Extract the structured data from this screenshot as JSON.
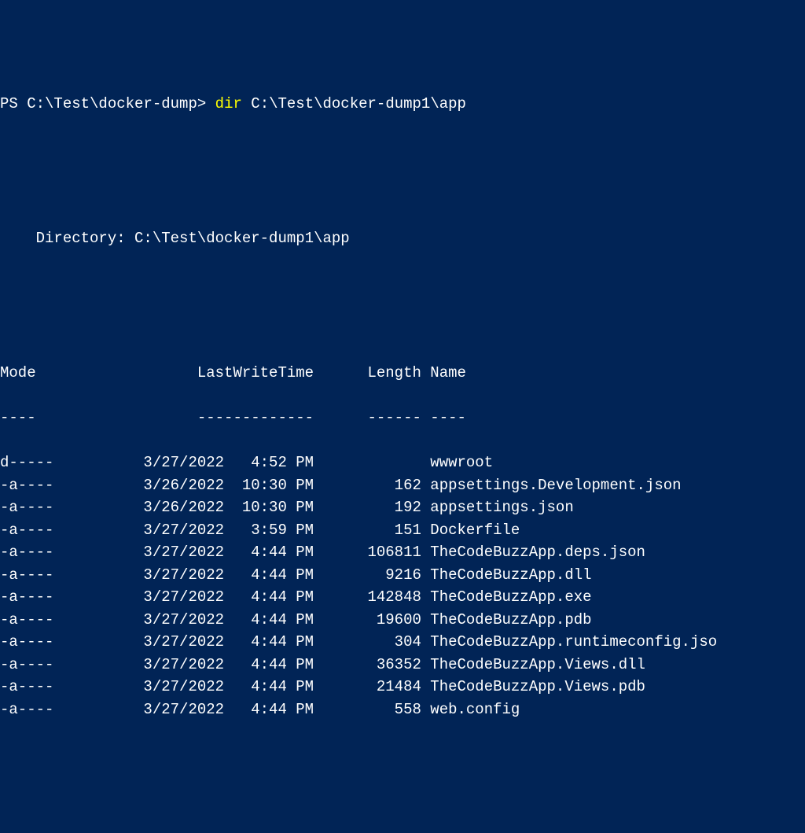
{
  "prompt": {
    "ps_prefix": "PS ",
    "cwd": "C:\\Test\\docker-dump",
    "separator": "> ",
    "command": "dir",
    "argument": " C:\\Test\\docker-dump1\\app"
  },
  "directory_label": "    Directory: ",
  "directory_path": "C:\\Test\\docker-dump1\\app",
  "headers": {
    "mode": "Mode",
    "lastwrite": "LastWriteTime",
    "length": "Length",
    "name": "Name"
  },
  "header_underlines": {
    "mode": "----",
    "lastwrite": "-------------",
    "length": "------",
    "name": "----"
  },
  "rows": [
    {
      "mode": "d-----",
      "date": "3/27/2022",
      "time": "4:52 PM",
      "length": "",
      "name": "wwwroot"
    },
    {
      "mode": "-a----",
      "date": "3/26/2022",
      "time": "10:30 PM",
      "length": "162",
      "name": "appsettings.Development.json"
    },
    {
      "mode": "-a----",
      "date": "3/26/2022",
      "time": "10:30 PM",
      "length": "192",
      "name": "appsettings.json"
    },
    {
      "mode": "-a----",
      "date": "3/27/2022",
      "time": "3:59 PM",
      "length": "151",
      "name": "Dockerfile"
    },
    {
      "mode": "-a----",
      "date": "3/27/2022",
      "time": "4:44 PM",
      "length": "106811",
      "name": "TheCodeBuzzApp.deps.json"
    },
    {
      "mode": "-a----",
      "date": "3/27/2022",
      "time": "4:44 PM",
      "length": "9216",
      "name": "TheCodeBuzzApp.dll"
    },
    {
      "mode": "-a----",
      "date": "3/27/2022",
      "time": "4:44 PM",
      "length": "142848",
      "name": "TheCodeBuzzApp.exe"
    },
    {
      "mode": "-a----",
      "date": "3/27/2022",
      "time": "4:44 PM",
      "length": "19600",
      "name": "TheCodeBuzzApp.pdb"
    },
    {
      "mode": "-a----",
      "date": "3/27/2022",
      "time": "4:44 PM",
      "length": "304",
      "name": "TheCodeBuzzApp.runtimeconfig.jso"
    },
    {
      "mode": "-a----",
      "date": "3/27/2022",
      "time": "4:44 PM",
      "length": "36352",
      "name": "TheCodeBuzzApp.Views.dll"
    },
    {
      "mode": "-a----",
      "date": "3/27/2022",
      "time": "4:44 PM",
      "length": "21484",
      "name": "TheCodeBuzzApp.Views.pdb"
    },
    {
      "mode": "-a----",
      "date": "3/27/2022",
      "time": "4:44 PM",
      "length": "558",
      "name": "web.config"
    }
  ]
}
